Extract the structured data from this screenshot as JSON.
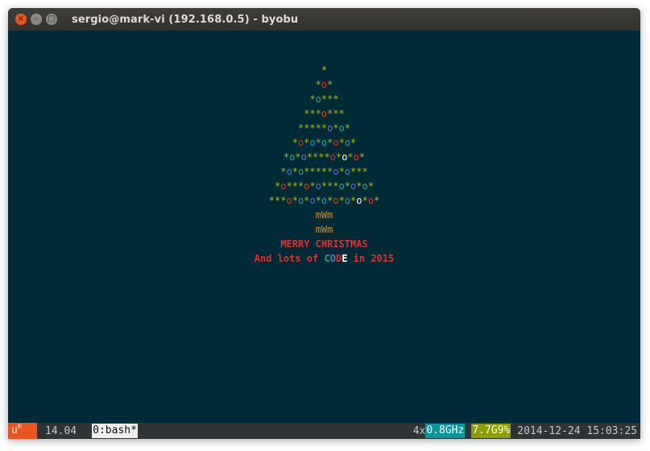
{
  "window": {
    "title": "sergio@mark-vi (192.168.0.5) - byobu",
    "buttons": {
      "close": "×",
      "minimize": "–",
      "maximize": "□"
    }
  },
  "tree": {
    "rows": [
      [
        [
          "*",
          "star"
        ]
      ],
      [
        [
          "*",
          "star"
        ],
        [
          "o",
          "#dc322f"
        ],
        [
          "*",
          "star"
        ]
      ],
      [
        [
          "*",
          "star"
        ],
        [
          "o",
          "#2aa198"
        ],
        [
          "***",
          "star"
        ]
      ],
      [
        [
          "***",
          "star"
        ],
        [
          "o",
          "#cb4b16"
        ],
        [
          "***",
          "star"
        ]
      ],
      [
        [
          "*****",
          "star"
        ],
        [
          "o",
          "#6c71c4"
        ],
        [
          "*",
          "star"
        ],
        [
          "o",
          "#2aa198"
        ],
        [
          "*",
          "star"
        ]
      ],
      [
        [
          "*",
          "star"
        ],
        [
          "o",
          "#dc322f"
        ],
        [
          "*",
          "star"
        ],
        [
          "o",
          "#268bd2"
        ],
        [
          "*",
          "star"
        ],
        [
          "o",
          "#2aa198"
        ],
        [
          "*",
          "star"
        ],
        [
          "o",
          "#dc322f"
        ],
        [
          "*",
          "star"
        ],
        [
          "o",
          "#2aa198"
        ],
        [
          "*",
          "star"
        ]
      ],
      [
        [
          "*",
          "star"
        ],
        [
          "o",
          "#2aa198"
        ],
        [
          "*",
          "star"
        ],
        [
          "o",
          "#6c71c4"
        ],
        [
          "****",
          "star"
        ],
        [
          "o",
          "#dc322f"
        ],
        [
          "*",
          "star"
        ],
        [
          "o",
          "#ffffff"
        ],
        [
          "*",
          "star"
        ],
        [
          "o",
          "#dc322f"
        ],
        [
          "*",
          "star"
        ]
      ],
      [
        [
          "*",
          "star"
        ],
        [
          "o",
          "#268bd2"
        ],
        [
          "*",
          "star"
        ],
        [
          "o",
          "#2aa198"
        ],
        [
          "*****",
          "star"
        ],
        [
          "o",
          "#6c71c4"
        ],
        [
          "*",
          "star"
        ],
        [
          "o",
          "#2aa198"
        ],
        [
          "***",
          "star"
        ]
      ],
      [
        [
          "*",
          "star"
        ],
        [
          "o",
          "#dc322f"
        ],
        [
          "***",
          "star"
        ],
        [
          "o",
          "#cb4b16"
        ],
        [
          "*",
          "star"
        ],
        [
          "o",
          "#6c71c4"
        ],
        [
          "***",
          "star"
        ],
        [
          "o",
          "#2aa198"
        ],
        [
          "*",
          "star"
        ],
        [
          "o",
          "#6c71c4"
        ],
        [
          "*",
          "star"
        ],
        [
          "o",
          "#2aa198"
        ],
        [
          "*",
          "star"
        ]
      ],
      [
        [
          "***",
          "star"
        ],
        [
          "o",
          "#cb4b16"
        ],
        [
          "*",
          "star"
        ],
        [
          "o",
          "#2aa198"
        ],
        [
          "*",
          "star"
        ],
        [
          "o",
          "#6c71c4"
        ],
        [
          "*",
          "star"
        ],
        [
          "o",
          "#2aa198"
        ],
        [
          "*",
          "star"
        ],
        [
          "o",
          "#cb4b16"
        ],
        [
          "*",
          "star"
        ],
        [
          "o",
          "#2aa198"
        ],
        [
          "*",
          "star"
        ],
        [
          "o",
          "#ffffff"
        ],
        [
          "*",
          "star"
        ],
        [
          "o",
          "#dc322f"
        ],
        [
          "*",
          "star"
        ]
      ]
    ],
    "trunk": [
      "mWm",
      "mWm"
    ],
    "greeting": "MERRY CHRISTMAS",
    "subline": [
      [
        "And lots of ",
        "#dc322f"
      ],
      [
        "C",
        "#2aa198"
      ],
      [
        "O",
        "#6c71c4"
      ],
      [
        "D",
        "#dc322f"
      ],
      [
        "E",
        "#ffffff"
      ],
      [
        " in 2015",
        "#dc322f"
      ]
    ]
  },
  "statusbar": {
    "logo": "u",
    "logo_mark": "®",
    "release": "14.04",
    "window_tab": "0:bash*",
    "cpu_count": "4x",
    "cpu_freq": "0.8GHz",
    "memory": "7.7G9%",
    "datetime": "2014-12-24 15:03:25"
  },
  "colors": {
    "terminal_bg": "#002b36",
    "star": "#b5b800",
    "trunk": "#d28a1a",
    "greeting": "#dc322f",
    "ubuntu_orange": "#e95420",
    "cpu_bg": "#06989a",
    "mem_bg": "#8ba000"
  }
}
